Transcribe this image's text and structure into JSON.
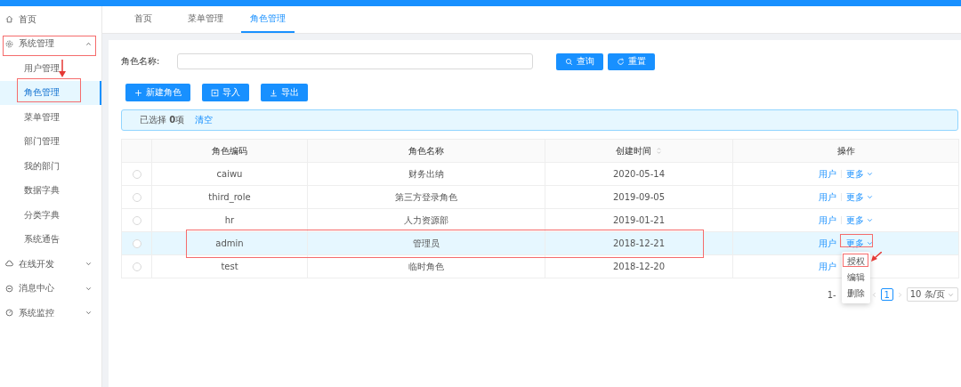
{
  "sidebar": {
    "items": [
      {
        "label": "首页",
        "kind": "home",
        "selected": false
      },
      {
        "label": "系统管理",
        "kind": "gear",
        "selected": false,
        "expanded": true,
        "children": [
          {
            "label": "用户管理",
            "selected": false
          },
          {
            "label": "角色管理",
            "selected": true
          },
          {
            "label": "菜单管理",
            "selected": false
          },
          {
            "label": "部门管理",
            "selected": false
          },
          {
            "label": "我的部门",
            "selected": false
          },
          {
            "label": "数据字典",
            "selected": false
          },
          {
            "label": "分类字典",
            "selected": false
          },
          {
            "label": "系统通告",
            "selected": false
          }
        ]
      },
      {
        "label": "在线开发",
        "kind": "cloud",
        "selected": false,
        "expanded": false
      },
      {
        "label": "消息中心",
        "kind": "message",
        "selected": false,
        "expanded": false
      },
      {
        "label": "系统监控",
        "kind": "dashboard",
        "selected": false,
        "expanded": false
      }
    ]
  },
  "tabs": [
    {
      "label": "首页",
      "selected": false
    },
    {
      "label": "菜单管理",
      "selected": false
    },
    {
      "label": "角色管理",
      "selected": true
    }
  ],
  "search": {
    "label": "角色名称:",
    "buttons": [
      {
        "label": "查询",
        "kind": "search"
      },
      {
        "label": "重置",
        "kind": "reset"
      }
    ]
  },
  "toolbar": [
    {
      "label": "新建角色",
      "kind": "add"
    },
    {
      "label": "导入",
      "kind": "import"
    },
    {
      "label": "导出",
      "kind": "export"
    }
  ],
  "alert": {
    "text": "已选择 **0**项",
    "action": "清空"
  },
  "table": {
    "columns": [
      {
        "label": "角色编码",
        "sortable": false
      },
      {
        "label": "角色名称",
        "sortable": false
      },
      {
        "label": "创建时间",
        "sortable": true
      },
      {
        "label": "操作",
        "sortable": false
      }
    ],
    "rows": [
      {
        "checked": false,
        "highlighted": false,
        "code": "caiwu",
        "name": "财务出纳",
        "created": "2020-05-14",
        "actions": [
          "用户",
          "更多"
        ]
      },
      {
        "checked": false,
        "highlighted": false,
        "code": "third_role",
        "name": "第三方登录角色",
        "created": "2019-09-05",
        "actions": [
          "用户",
          "更多"
        ]
      },
      {
        "checked": false,
        "highlighted": false,
        "code": "hr",
        "name": "人力资源部",
        "created": "2019-01-21",
        "actions": [
          "用户",
          "更多"
        ]
      },
      {
        "checked": false,
        "highlighted": true,
        "code": "admin",
        "name": "管理员",
        "created": "2018-12-21",
        "actions": [
          "用户",
          "更多"
        ]
      },
      {
        "checked": false,
        "highlighted": false,
        "code": "test",
        "name": "临时角色",
        "created": "2018-12-20",
        "actions": [
          "用户"
        ]
      }
    ]
  },
  "dropdown": {
    "items": [
      "授权",
      "编辑",
      "删除"
    ]
  },
  "pagination": {
    "range": "1-",
    "pages": [
      {
        "label": "1",
        "selected": true
      }
    ],
    "page_size": "10 条/页"
  }
}
